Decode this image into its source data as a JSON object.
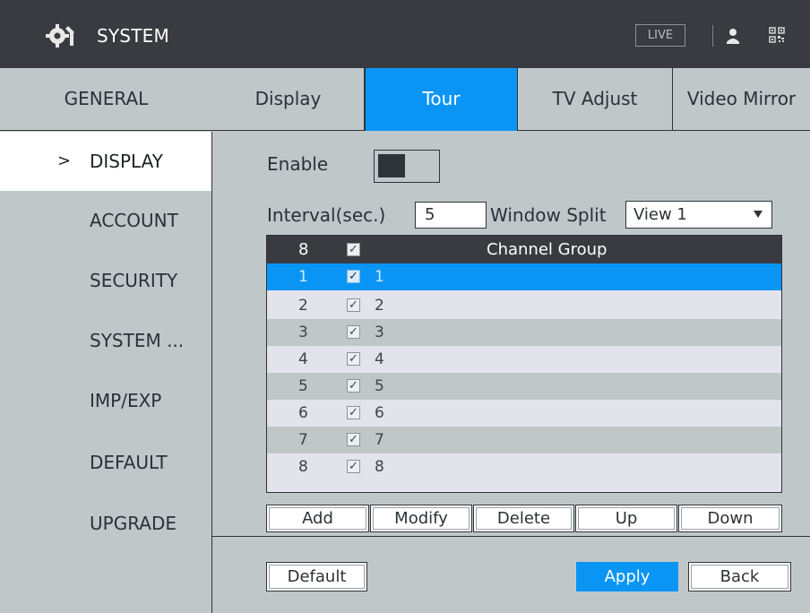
{
  "header": {
    "title": "SYSTEM",
    "live_label": "LIVE",
    "icons": [
      "settings-gear-icon",
      "user-icon",
      "qr-code-icon"
    ]
  },
  "tabs": [
    {
      "label": "GENERAL",
      "active": false
    },
    {
      "label": "Display",
      "active": false
    },
    {
      "label": "Tour",
      "active": true
    },
    {
      "label": "TV Adjust",
      "active": false
    },
    {
      "label": "Video Mirror",
      "active": false
    }
  ],
  "sidebar": {
    "items": [
      {
        "label": "DISPLAY",
        "active": true,
        "indicator": ">"
      },
      {
        "label": "ACCOUNT",
        "active": false
      },
      {
        "label": "SECURITY",
        "active": false
      },
      {
        "label": "SYSTEM ...",
        "active": false
      },
      {
        "label": "IMP/EXP",
        "active": false
      },
      {
        "label": "DEFAULT",
        "active": false
      },
      {
        "label": "UPGRADE",
        "active": false
      }
    ]
  },
  "form": {
    "enable_label": "Enable",
    "enable_on": false,
    "interval_label": "Interval(sec.)",
    "interval_value": "5",
    "window_split_label": "Window Split",
    "window_split_value": "View 1"
  },
  "table": {
    "header": {
      "count": "8",
      "check": "✓",
      "title": "Channel Group"
    },
    "rows": [
      {
        "num": "1",
        "check": "✓",
        "channels": "1",
        "selected": true
      },
      {
        "num": "2",
        "check": "✓",
        "channels": "2"
      },
      {
        "num": "3",
        "check": "✓",
        "channels": "3"
      },
      {
        "num": "4",
        "check": "✓",
        "channels": "4"
      },
      {
        "num": "5",
        "check": "✓",
        "channels": "5"
      },
      {
        "num": "6",
        "check": "✓",
        "channels": "6"
      },
      {
        "num": "7",
        "check": "✓",
        "channels": "7"
      },
      {
        "num": "8",
        "check": "✓",
        "channels": "8"
      }
    ]
  },
  "actions": {
    "add": "Add",
    "modify": "Modify",
    "delete": "Delete",
    "up": "Up",
    "down": "Down"
  },
  "footer": {
    "default": "Default",
    "apply": "Apply",
    "back": "Back"
  },
  "colors": {
    "accent": "#0a95f5",
    "header_bg": "#3a3b41",
    "panel_bg": "#bfc7c9",
    "row_alt": "#e3e3ec"
  }
}
